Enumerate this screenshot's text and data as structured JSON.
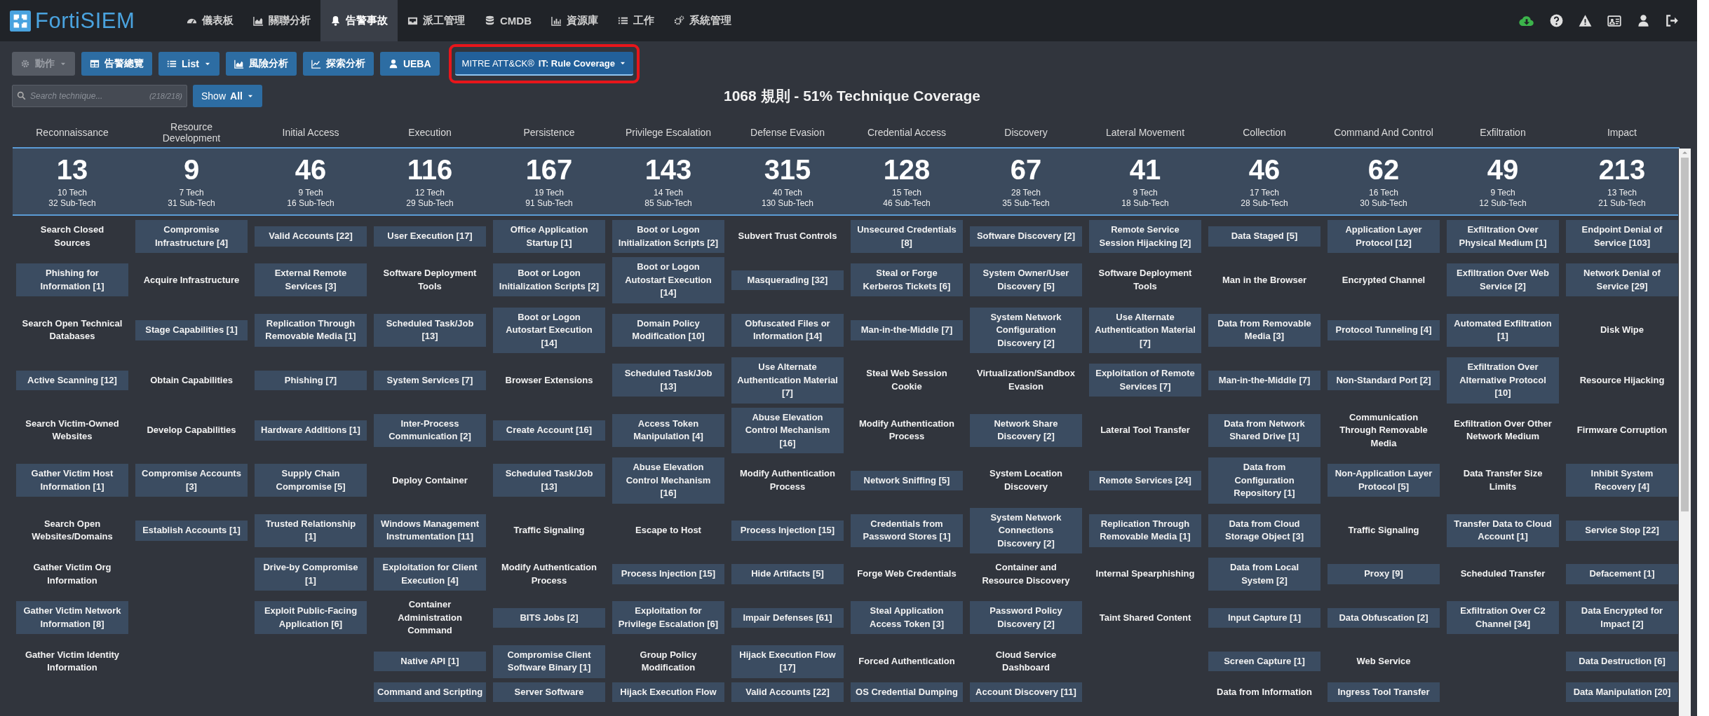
{
  "logo": "FortiSIEM",
  "nav": [
    {
      "label": "儀表板",
      "selected": false
    },
    {
      "label": "關聯分析",
      "selected": false
    },
    {
      "label": "告警事故",
      "selected": true
    },
    {
      "label": "派工管理",
      "selected": false
    },
    {
      "label": "CMDB",
      "selected": false
    },
    {
      "label": "資源庫",
      "selected": false
    },
    {
      "label": "工作",
      "selected": false
    },
    {
      "label": "系統管理",
      "selected": false
    }
  ],
  "toolbar": {
    "actions": {
      "label": "動作",
      "disabled": true
    },
    "buttons": [
      {
        "label": "告警總覽",
        "dropdown": false
      },
      {
        "label": "List",
        "dropdown": true
      },
      {
        "label": "風險分析",
        "dropdown": false
      },
      {
        "label": "探索分析",
        "dropdown": false
      },
      {
        "label": "UEBA",
        "dropdown": false
      }
    ],
    "view": {
      "prefix": "MITRE ATT&CK®",
      "label": "IT: Rule Coverage",
      "highlighted": true
    }
  },
  "search": {
    "placeholder": "Search technique...",
    "count": "(218/218)"
  },
  "show": {
    "label": "Show",
    "value": "All"
  },
  "title": "1068 規則 - 51% Technique Coverage",
  "tactics": [
    {
      "name": "Reconnaissance",
      "count": "13",
      "tech": "10 Tech",
      "sub_tech": "32 Sub-Tech",
      "techniques": [
        {
          "name": "Search Closed Sources",
          "covered": false
        },
        {
          "name": "Phishing for Information [1]",
          "covered": true
        },
        {
          "name": "Search Open Technical Databases",
          "covered": false
        },
        {
          "name": "Active Scanning [12]",
          "covered": true
        },
        {
          "name": "Search Victim-Owned Websites",
          "covered": false
        },
        {
          "name": "Gather Victim Host Information [1]",
          "covered": true
        },
        {
          "name": "Search Open Websites/Domains",
          "covered": false
        },
        {
          "name": "Gather Victim Org Information",
          "covered": false
        },
        {
          "name": "Gather Victim Network Information [8]",
          "covered": true
        },
        {
          "name": "Gather Victim Identity Information",
          "covered": false
        }
      ]
    },
    {
      "name": "Resource\nDevelopment",
      "count": "9",
      "tech": "7 Tech",
      "sub_tech": "31 Sub-Tech",
      "techniques": [
        {
          "name": "Compromise Infrastructure [4]",
          "covered": true
        },
        {
          "name": "Acquire Infrastructure",
          "covered": false
        },
        {
          "name": "Stage Capabilities [1]",
          "covered": true
        },
        {
          "name": "Obtain Capabilities",
          "covered": false
        },
        {
          "name": "Develop Capabilities",
          "covered": false
        },
        {
          "name": "Compromise Accounts [3]",
          "covered": true
        },
        {
          "name": "Establish Accounts [1]",
          "covered": true
        }
      ]
    },
    {
      "name": "Initial Access",
      "count": "46",
      "tech": "9 Tech",
      "sub_tech": "16 Sub-Tech",
      "techniques": [
        {
          "name": "Valid Accounts [22]",
          "covered": true
        },
        {
          "name": "External Remote Services [3]",
          "covered": true
        },
        {
          "name": "Replication Through Removable Media [1]",
          "covered": true
        },
        {
          "name": "Phishing [7]",
          "covered": true
        },
        {
          "name": "Hardware Additions [1]",
          "covered": true
        },
        {
          "name": "Supply Chain Compromise [5]",
          "covered": true
        },
        {
          "name": "Trusted Relationship [1]",
          "covered": true
        },
        {
          "name": "Drive-by Compromise [1]",
          "covered": true
        },
        {
          "name": "Exploit Public-Facing Application [6]",
          "covered": true
        }
      ]
    },
    {
      "name": "Execution",
      "count": "116",
      "tech": "12 Tech",
      "sub_tech": "29 Sub-Tech",
      "techniques": [
        {
          "name": "User Execution [17]",
          "covered": true
        },
        {
          "name": "Software Deployment Tools",
          "covered": false
        },
        {
          "name": "Scheduled Task/Job [13]",
          "covered": true
        },
        {
          "name": "System Services [7]",
          "covered": true
        },
        {
          "name": "Inter-Process Communication [2]",
          "covered": true
        },
        {
          "name": "Deploy Container",
          "covered": false
        },
        {
          "name": "Windows Management Instrumentation [11]",
          "covered": true
        },
        {
          "name": "Exploitation for Client Execution [4]",
          "covered": true
        },
        {
          "name": "Container Administration Command",
          "covered": false
        },
        {
          "name": "Native API [1]",
          "covered": true
        },
        {
          "name": "Command and Scripting",
          "covered": true
        }
      ]
    },
    {
      "name": "Persistence",
      "count": "167",
      "tech": "19 Tech",
      "sub_tech": "91 Sub-Tech",
      "techniques": [
        {
          "name": "Office Application Startup [1]",
          "covered": true
        },
        {
          "name": "Boot or Logon Initialization Scripts [2]",
          "covered": true
        },
        {
          "name": "Boot or Logon Autostart Execution [14]",
          "covered": true
        },
        {
          "name": "Browser Extensions",
          "covered": false
        },
        {
          "name": "Create Account [16]",
          "covered": true
        },
        {
          "name": "Scheduled Task/Job [13]",
          "covered": true
        },
        {
          "name": "Traffic Signaling",
          "covered": false
        },
        {
          "name": "Modify Authentication Process",
          "covered": false
        },
        {
          "name": "BITS Jobs [2]",
          "covered": true
        },
        {
          "name": "Compromise Client Software Binary [1]",
          "covered": true
        },
        {
          "name": "Server Software",
          "covered": true
        }
      ]
    },
    {
      "name": "Privilege Escalation",
      "count": "143",
      "tech": "14 Tech",
      "sub_tech": "85 Sub-Tech",
      "techniques": [
        {
          "name": "Boot or Logon Initialization Scripts [2]",
          "covered": true
        },
        {
          "name": "Boot or Logon Autostart Execution [14]",
          "covered": true
        },
        {
          "name": "Domain Policy Modification [10]",
          "covered": true
        },
        {
          "name": "Scheduled Task/Job [13]",
          "covered": true
        },
        {
          "name": "Access Token Manipulation [4]",
          "covered": true
        },
        {
          "name": "Abuse Elevation Control Mechanism [16]",
          "covered": true
        },
        {
          "name": "Escape to Host",
          "covered": false
        },
        {
          "name": "Process Injection [15]",
          "covered": true
        },
        {
          "name": "Exploitation for Privilege Escalation [6]",
          "covered": true
        },
        {
          "name": "Group Policy Modification",
          "covered": false
        },
        {
          "name": "Hijack Execution Flow",
          "covered": true
        }
      ]
    },
    {
      "name": "Defense Evasion",
      "count": "315",
      "tech": "40 Tech",
      "sub_tech": "130 Sub-Tech",
      "techniques": [
        {
          "name": "Subvert Trust Controls",
          "covered": false
        },
        {
          "name": "Masquerading [32]",
          "covered": true
        },
        {
          "name": "Obfuscated Files or Information [14]",
          "covered": true
        },
        {
          "name": "Use Alternate Authentication Material [7]",
          "covered": true
        },
        {
          "name": "Abuse Elevation Control Mechanism [16]",
          "covered": true
        },
        {
          "name": "Modify Authentication Process",
          "covered": false
        },
        {
          "name": "Process Injection [15]",
          "covered": true
        },
        {
          "name": "Hide Artifacts [5]",
          "covered": true
        },
        {
          "name": "Impair Defenses [61]",
          "covered": true
        },
        {
          "name": "Hijack Execution Flow [17]",
          "covered": true
        },
        {
          "name": "Valid Accounts [22]",
          "covered": true
        }
      ]
    },
    {
      "name": "Credential Access",
      "count": "128",
      "tech": "15 Tech",
      "sub_tech": "46 Sub-Tech",
      "techniques": [
        {
          "name": "Unsecured Credentials [8]",
          "covered": true
        },
        {
          "name": "Steal or Forge Kerberos Tickets [6]",
          "covered": true
        },
        {
          "name": "Man-in-the-Middle [7]",
          "covered": true
        },
        {
          "name": "Steal Web Session Cookie",
          "covered": false
        },
        {
          "name": "Modify Authentication Process",
          "covered": false
        },
        {
          "name": "Network Sniffing [5]",
          "covered": true
        },
        {
          "name": "Credentials from Password Stores [1]",
          "covered": true
        },
        {
          "name": "Forge Web Credentials",
          "covered": false
        },
        {
          "name": "Steal Application Access Token [3]",
          "covered": true
        },
        {
          "name": "Forced Authentication",
          "covered": false
        },
        {
          "name": "OS Credential Dumping",
          "covered": true
        }
      ]
    },
    {
      "name": "Discovery",
      "count": "67",
      "tech": "28 Tech",
      "sub_tech": "35 Sub-Tech",
      "techniques": [
        {
          "name": "Software Discovery [2]",
          "covered": true
        },
        {
          "name": "System Owner/User Discovery [5]",
          "covered": true
        },
        {
          "name": "System Network Configuration Discovery [2]",
          "covered": true
        },
        {
          "name": "Virtualization/Sandbox Evasion",
          "covered": false
        },
        {
          "name": "Network Share Discovery [2]",
          "covered": true
        },
        {
          "name": "System Location Discovery",
          "covered": false
        },
        {
          "name": "System Network Connections Discovery [2]",
          "covered": true
        },
        {
          "name": "Container and Resource Discovery",
          "covered": false
        },
        {
          "name": "Password Policy Discovery [2]",
          "covered": true
        },
        {
          "name": "Cloud Service Dashboard",
          "covered": false
        },
        {
          "name": "Account Discovery [11]",
          "covered": true
        }
      ]
    },
    {
      "name": "Lateral Movement",
      "count": "41",
      "tech": "9 Tech",
      "sub_tech": "18 Sub-Tech",
      "techniques": [
        {
          "name": "Remote Service Session Hijacking [2]",
          "covered": true
        },
        {
          "name": "Software Deployment Tools",
          "covered": false
        },
        {
          "name": "Use Alternate Authentication Material [7]",
          "covered": true
        },
        {
          "name": "Exploitation of Remote Services [7]",
          "covered": true
        },
        {
          "name": "Lateral Tool Transfer",
          "covered": false
        },
        {
          "name": "Remote Services [24]",
          "covered": true
        },
        {
          "name": "Replication Through Removable Media [1]",
          "covered": true
        },
        {
          "name": "Internal Spearphishing",
          "covered": false
        },
        {
          "name": "Taint Shared Content",
          "covered": false
        }
      ]
    },
    {
      "name": "Collection",
      "count": "46",
      "tech": "17 Tech",
      "sub_tech": "28 Sub-Tech",
      "techniques": [
        {
          "name": "Data Staged [5]",
          "covered": true
        },
        {
          "name": "Man in the Browser",
          "covered": false
        },
        {
          "name": "Data from Removable Media [3]",
          "covered": true
        },
        {
          "name": "Man-in-the-Middle [7]",
          "covered": true
        },
        {
          "name": "Data from Network Shared Drive [1]",
          "covered": true
        },
        {
          "name": "Data from Configuration Repository [1]",
          "covered": true
        },
        {
          "name": "Data from Cloud Storage Object [3]",
          "covered": true
        },
        {
          "name": "Data from Local System [2]",
          "covered": true
        },
        {
          "name": "Input Capture [1]",
          "covered": true
        },
        {
          "name": "Screen Capture [1]",
          "covered": true
        },
        {
          "name": "Data from Information",
          "covered": false
        }
      ]
    },
    {
      "name": "Command And Control",
      "count": "62",
      "tech": "16 Tech",
      "sub_tech": "30 Sub-Tech",
      "techniques": [
        {
          "name": "Application Layer Protocol [12]",
          "covered": true
        },
        {
          "name": "Encrypted Channel",
          "covered": false
        },
        {
          "name": "Protocol Tunneling [4]",
          "covered": true
        },
        {
          "name": "Non-Standard Port [2]",
          "covered": true
        },
        {
          "name": "Communication Through Removable Media",
          "covered": false
        },
        {
          "name": "Non-Application Layer Protocol [5]",
          "covered": true
        },
        {
          "name": "Traffic Signaling",
          "covered": false
        },
        {
          "name": "Proxy [9]",
          "covered": true
        },
        {
          "name": "Data Obfuscation [2]",
          "covered": true
        },
        {
          "name": "Web Service",
          "covered": false
        },
        {
          "name": "Ingress Tool Transfer",
          "covered": true
        }
      ]
    },
    {
      "name": "Exfiltration",
      "count": "49",
      "tech": "9 Tech",
      "sub_tech": "12 Sub-Tech",
      "techniques": [
        {
          "name": "Exfiltration Over Physical Medium [1]",
          "covered": true
        },
        {
          "name": "Exfiltration Over Web Service [2]",
          "covered": true
        },
        {
          "name": "Automated Exfiltration [1]",
          "covered": true
        },
        {
          "name": "Exfiltration Over Alternative Protocol [10]",
          "covered": true
        },
        {
          "name": "Exfiltration Over Other Network Medium",
          "covered": false
        },
        {
          "name": "Data Transfer Size Limits",
          "covered": false
        },
        {
          "name": "Transfer Data to Cloud Account [1]",
          "covered": true
        },
        {
          "name": "Scheduled Transfer",
          "covered": false
        },
        {
          "name": "Exfiltration Over C2 Channel [34]",
          "covered": true
        }
      ]
    },
    {
      "name": "Impact",
      "count": "213",
      "tech": "13 Tech",
      "sub_tech": "21 Sub-Tech",
      "techniques": [
        {
          "name": "Endpoint Denial of Service [103]",
          "covered": true
        },
        {
          "name": "Network Denial of Service [29]",
          "covered": true
        },
        {
          "name": "Disk Wipe",
          "covered": false
        },
        {
          "name": "Resource Hijacking",
          "covered": false
        },
        {
          "name": "Firmware Corruption",
          "covered": false
        },
        {
          "name": "Inhibit System Recovery [4]",
          "covered": true
        },
        {
          "name": "Service Stop [22]",
          "covered": true
        },
        {
          "name": "Defacement [1]",
          "covered": true
        },
        {
          "name": "Data Encrypted for Impact [2]",
          "covered": true
        },
        {
          "name": "Data Destruction [6]",
          "covered": true
        },
        {
          "name": "Data Manipulation [20]",
          "covered": true
        }
      ]
    }
  ]
}
